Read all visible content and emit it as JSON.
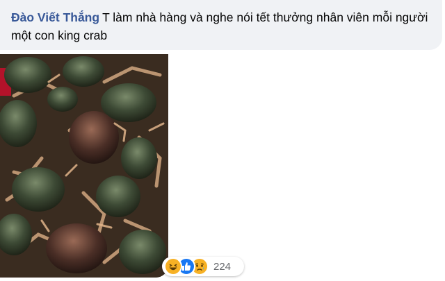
{
  "comment": {
    "author": "Đào Viết Thắng",
    "text": "T làm nhà hàng và nghe nói tết thưởng nhân viên mỗi người một con king crab"
  },
  "reactions": {
    "icons": [
      "haha-icon",
      "like-icon",
      "sad-icon"
    ],
    "count": "224"
  },
  "colors": {
    "bubble_bg": "#f0f2f5",
    "author": "#385898",
    "like": "#1877f2",
    "emoji_yellow": "#f7b125"
  }
}
